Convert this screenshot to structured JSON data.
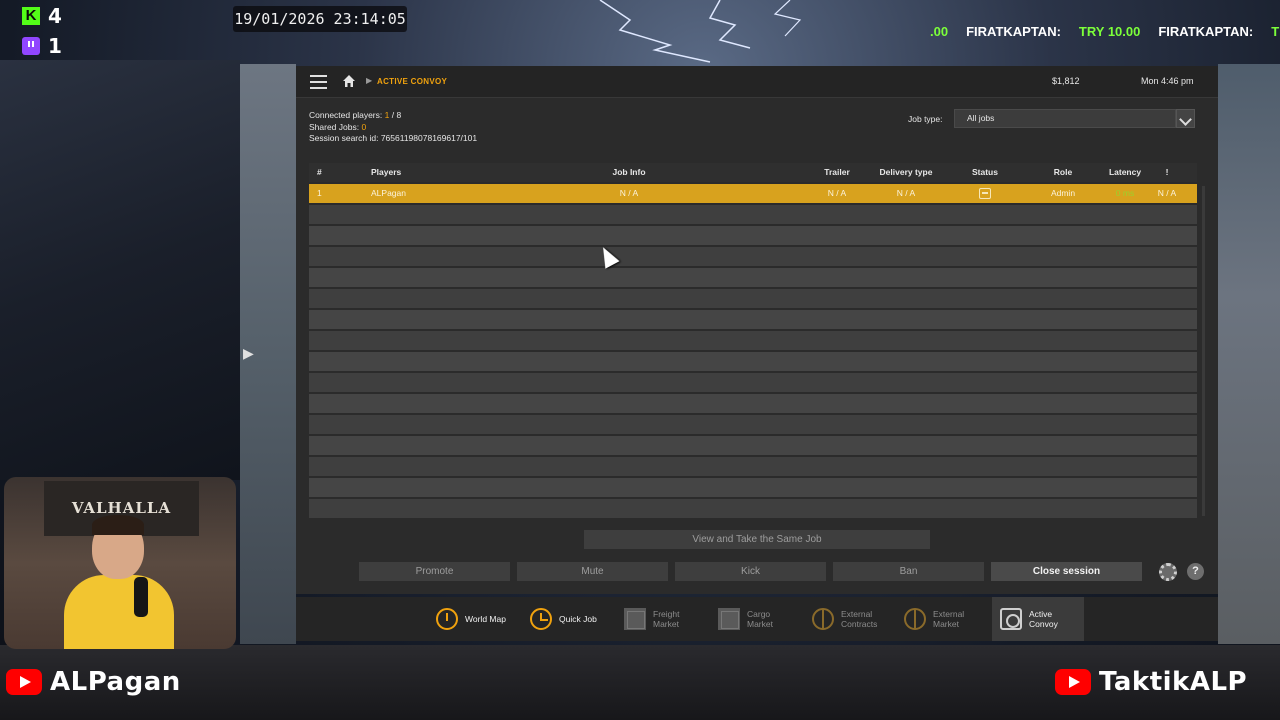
{
  "overlay": {
    "kick_count": "4",
    "twitch_count": "1",
    "datetime": "19/01/2026 23:14:05",
    "ticker": [
      {
        "text": ".00",
        "color": "green"
      },
      {
        "text": "FIRATKAPTAN:",
        "color": "white"
      },
      {
        "text": "TRY 10.00",
        "color": "green"
      },
      {
        "text": "FIRATKAPTAN:",
        "color": "white"
      },
      {
        "text": "TRY",
        "color": "green"
      }
    ],
    "webcam_banner": "VALHALLA",
    "channel_left": "ALPagan",
    "channel_right": "TaktikALP"
  },
  "game": {
    "topbar": {
      "breadcrumb": "ACTIVE CONVOY",
      "money": "$1,812",
      "time": "Mon 4:46 pm"
    },
    "session": {
      "connected_label": "Connected players:",
      "connected_current": "1",
      "connected_sep": " / ",
      "connected_max": "8",
      "shared_label": "Shared Jobs:",
      "shared_value": "0",
      "search_label": "Session search id:",
      "search_value": "76561198078169617/101"
    },
    "filter": {
      "label": "Job type:",
      "value": "All jobs"
    },
    "table": {
      "headers": {
        "num": "#",
        "players": "Players",
        "job_info": "Job Info",
        "trailer": "Trailer",
        "delivery": "Delivery type",
        "status": "Status",
        "role": "Role",
        "latency": "Latency",
        "excl": "!"
      },
      "rows": [
        {
          "num": "1",
          "player": "ALPagan",
          "job_info": "N / A",
          "trailer": "N / A",
          "delivery": "N / A",
          "status_icon": "truck-icon",
          "role": "Admin",
          "latency": "0 ms",
          "excl": "N / A"
        }
      ]
    },
    "buttons": {
      "same_job": "View and Take the Same Job",
      "promote": "Promote",
      "mute": "Mute",
      "kick": "Kick",
      "ban": "Ban",
      "close_session": "Close session",
      "help": "?"
    },
    "menu": {
      "world_map": "World Map",
      "quick_job": "Quick Job",
      "freight_1": "Freight",
      "freight_2": "Market",
      "cargo_1": "Cargo",
      "cargo_2": "Market",
      "extc_1": "External",
      "extc_2": "Contracts",
      "extm_1": "External",
      "extm_2": "Market",
      "convoy_1": "Active",
      "convoy_2": "Convoy"
    },
    "colors": {
      "accent": "#f0a20e",
      "selected_row": "#d8a21e",
      "latency_ok": "#9bd22c"
    }
  }
}
